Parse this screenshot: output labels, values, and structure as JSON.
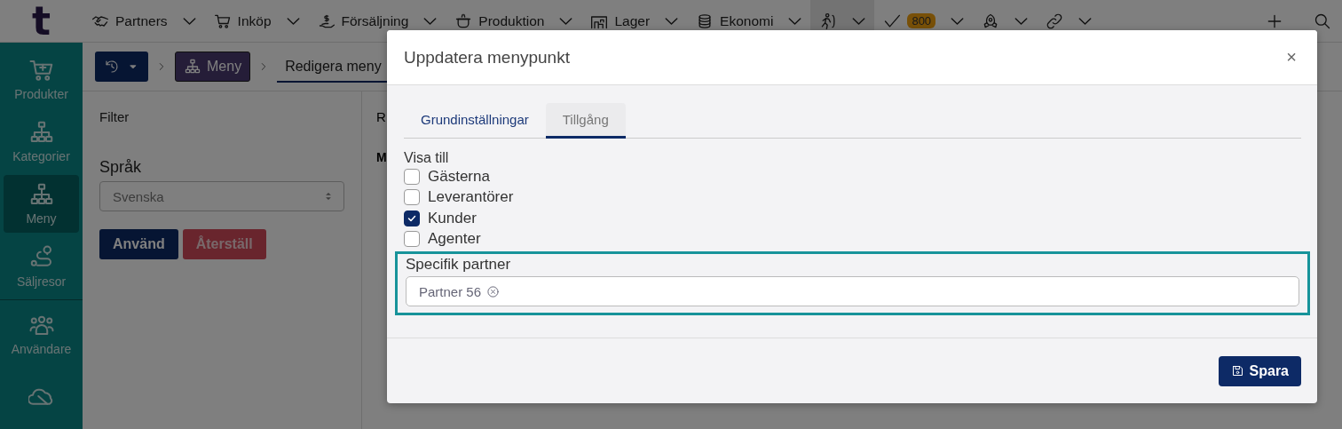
{
  "app": {
    "logo": "t"
  },
  "top_nav": [
    {
      "kind": "menu",
      "label": "Partners",
      "selected": false
    },
    {
      "kind": "menu",
      "label": "Inköp",
      "selected": false
    },
    {
      "kind": "menu",
      "label": "Försäljning",
      "selected": false
    },
    {
      "kind": "menu",
      "label": "Produktion",
      "selected": false
    },
    {
      "kind": "menu",
      "label": "Lager",
      "selected": false
    },
    {
      "kind": "menu",
      "label": "Ekonomi",
      "selected": false
    },
    {
      "kind": "icon",
      "selected": true
    },
    {
      "kind": "badge",
      "badge": "800",
      "selected": false
    },
    {
      "kind": "icon",
      "selected": false
    },
    {
      "kind": "icon",
      "selected": false
    }
  ],
  "sidebar": {
    "items": [
      {
        "label": "Produkter",
        "selected": false
      },
      {
        "label": "Kategorier",
        "selected": false
      },
      {
        "label": "Meny",
        "selected": true
      },
      {
        "label": "Säljresor",
        "selected": false
      },
      {
        "label": "Användare",
        "selected": false
      },
      {
        "selected": false
      }
    ]
  },
  "breadcrumb": {
    "current_section": "Meny",
    "page": "Redigera meny"
  },
  "filter": {
    "title": "Filter",
    "language_label": "Språk",
    "language": "Svenska",
    "apply_button": "Använd",
    "reset_button": "Återställ"
  },
  "right_panel": {
    "title": "R",
    "column_1": "M"
  },
  "dialog": {
    "title": "Uppdatera menypunkt",
    "close": "×",
    "tabs": [
      {
        "label": "Grundinställningar",
        "selected": false
      },
      {
        "label": "Tillgång",
        "selected": true
      }
    ],
    "visibility": {
      "label": "Visa till",
      "options": [
        {
          "label": "Gästerna",
          "checked": false
        },
        {
          "label": "Leverantörer",
          "checked": false
        },
        {
          "label": "Kunder",
          "checked": true
        },
        {
          "label": "Agenter",
          "checked": false
        }
      ]
    },
    "specific_partner": {
      "label": "Specifik partner",
      "highlighted": true,
      "tags": [
        "Partner 56"
      ]
    },
    "save_button": "Spara"
  }
}
